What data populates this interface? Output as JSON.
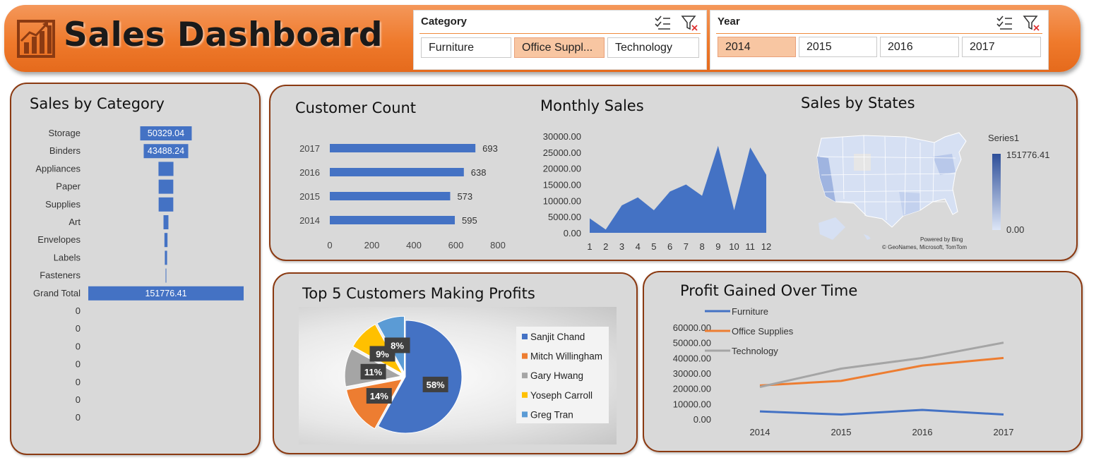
{
  "header": {
    "title": "Sales Dashboard",
    "logo_icon": "bar-chart-growth-icon"
  },
  "category_slicer": {
    "title": "Category",
    "items": [
      {
        "label": "Furniture",
        "selected": false
      },
      {
        "label": "Office Suppl...",
        "selected": true
      },
      {
        "label": "Technology",
        "selected": false
      }
    ]
  },
  "year_slicer": {
    "title": "Year",
    "items": [
      {
        "label": "2014",
        "selected": true
      },
      {
        "label": "2015",
        "selected": false
      },
      {
        "label": "2016",
        "selected": false
      },
      {
        "label": "2017",
        "selected": false
      }
    ]
  },
  "colors": {
    "accent": "#ef7a2c",
    "bar": "#4472c4",
    "orange": "#ed7d31",
    "gray": "#a5a5a5",
    "gold": "#ffc000",
    "lightblue": "#5b9bd5",
    "panel": "#d9d9d9",
    "border": "#8b3a12"
  },
  "panels": {
    "sales_by_category": "Sales by Category",
    "customer_count": "Customer Count",
    "monthly_sales": "Monthly Sales",
    "sales_by_states": "Sales by States",
    "top5": "Top 5 Customers Making Profits",
    "profit_time": "Profit Gained Over Time"
  },
  "map": {
    "legend_title": "Series1",
    "max": "151776.41",
    "min": "0.00",
    "credit1": "Powered by Bing",
    "credit2": "© GeoNames, Microsoft, TomTom"
  },
  "chart_data": [
    {
      "id": "sales_by_category",
      "type": "bar",
      "title": "Sales by Category",
      "categories": [
        "Storage",
        "Binders",
        "Appliances",
        "Paper",
        "Supplies",
        "Art",
        "Envelopes",
        "Labels",
        "Fasteners",
        "Grand Total",
        "0",
        "0",
        "0",
        "0",
        "0",
        "0",
        "0"
      ],
      "values": [
        50329.04,
        43488.24,
        14600,
        14300,
        14300,
        4800,
        3000,
        2200,
        700,
        151776.41,
        null,
        null,
        null,
        null,
        null,
        null,
        null
      ],
      "data_labels": [
        "50329.04",
        "43488.24",
        "",
        "",
        "",
        "",
        "",
        "",
        "",
        "151776.41"
      ]
    },
    {
      "id": "customer_count",
      "type": "bar",
      "title": "Customer Count",
      "categories": [
        "2017",
        "2016",
        "2015",
        "2014"
      ],
      "values": [
        693,
        638,
        573,
        595
      ],
      "xlim": [
        0,
        800
      ],
      "xticks": [
        "0",
        "200",
        "400",
        "600",
        "800"
      ]
    },
    {
      "id": "monthly_sales",
      "type": "area",
      "title": "Monthly Sales",
      "x": [
        1,
        2,
        3,
        4,
        5,
        6,
        7,
        8,
        9,
        10,
        11,
        12
      ],
      "values": [
        4500,
        1000,
        8500,
        11000,
        7000,
        12800,
        15000,
        11500,
        27000,
        7000,
        26500,
        18000
      ],
      "ylim": [
        0,
        30000
      ],
      "yticks": [
        "0.00",
        "5000.00",
        "10000.00",
        "15000.00",
        "20000.00",
        "25000.00",
        "30000.00"
      ],
      "xticks": [
        "1",
        "2",
        "3",
        "4",
        "5",
        "6",
        "7",
        "8",
        "9",
        "10",
        "11",
        "12"
      ]
    },
    {
      "id": "top5",
      "type": "pie",
      "title": "Top 5 Customers Making Profits",
      "categories": [
        "Sanjit Chand",
        "Mitch Willingham",
        "Gary Hwang",
        "Yoseph Carroll",
        "Greg Tran"
      ],
      "values": [
        58,
        14,
        11,
        9,
        8
      ],
      "labels": [
        "58%",
        "14%",
        "11%",
        "9%",
        "8%"
      ],
      "legend": "right"
    },
    {
      "id": "profit_time",
      "type": "line",
      "title": "Profit Gained Over Time",
      "x": [
        "2014",
        "2015",
        "2016",
        "2017"
      ],
      "series": [
        {
          "name": "Furniture",
          "values": [
            5000,
            3000,
            6000,
            3000
          ]
        },
        {
          "name": "Office Supplies",
          "values": [
            22000,
            25000,
            35000,
            40000
          ]
        },
        {
          "name": "Technology",
          "values": [
            21000,
            33000,
            40000,
            50000
          ]
        }
      ],
      "ylim": [
        0,
        60000
      ],
      "yticks": [
        "0.00",
        "10000.00",
        "20000.00",
        "30000.00",
        "40000.00",
        "50000.00",
        "60000.00"
      ],
      "legend": "top-left"
    }
  ]
}
